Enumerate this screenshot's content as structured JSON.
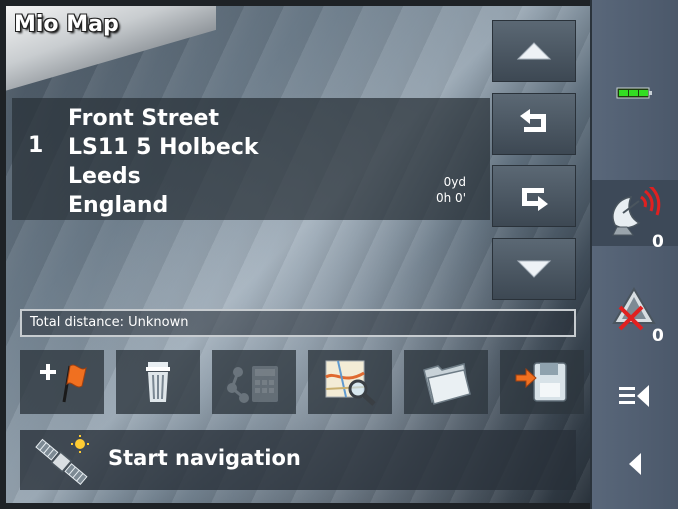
{
  "app": {
    "title": "Mio Map"
  },
  "route": {
    "index": "1",
    "address_lines": [
      "Front Street",
      "LS11 5 Holbeck",
      "Leeds",
      "England"
    ],
    "distance": "0yd",
    "time": "0h 0'",
    "total_distance": "Total distance: Unknown"
  },
  "nav_buttons": [
    {
      "name": "move-up",
      "icon": "triangle-up-icon"
    },
    {
      "name": "back",
      "icon": "return-left-icon"
    },
    {
      "name": "forward",
      "icon": "return-right-icon"
    },
    {
      "name": "move-down",
      "icon": "triangle-down-icon"
    }
  ],
  "toolbar": [
    {
      "name": "add-waypoint",
      "icon": "flag-add-icon"
    },
    {
      "name": "delete",
      "icon": "trash-icon"
    },
    {
      "name": "calculate-route",
      "icon": "route-calculator-icon",
      "disabled": true
    },
    {
      "name": "view-on-map",
      "icon": "map-search-icon"
    },
    {
      "name": "open-route",
      "icon": "folder-icon"
    },
    {
      "name": "save-route",
      "icon": "save-icon"
    }
  ],
  "start": {
    "label": "Start navigation",
    "icon": "satellite-icon"
  },
  "sidebar": {
    "battery_icon": "battery-icon",
    "gps_count": "0",
    "alerts_count": "0",
    "menu_icon": "menu-back-icon",
    "back_icon": "back-arrow-icon"
  },
  "colors": {
    "battery": "#33dd22",
    "alert_red": "#e02020",
    "flag_orange": "#f07020"
  }
}
